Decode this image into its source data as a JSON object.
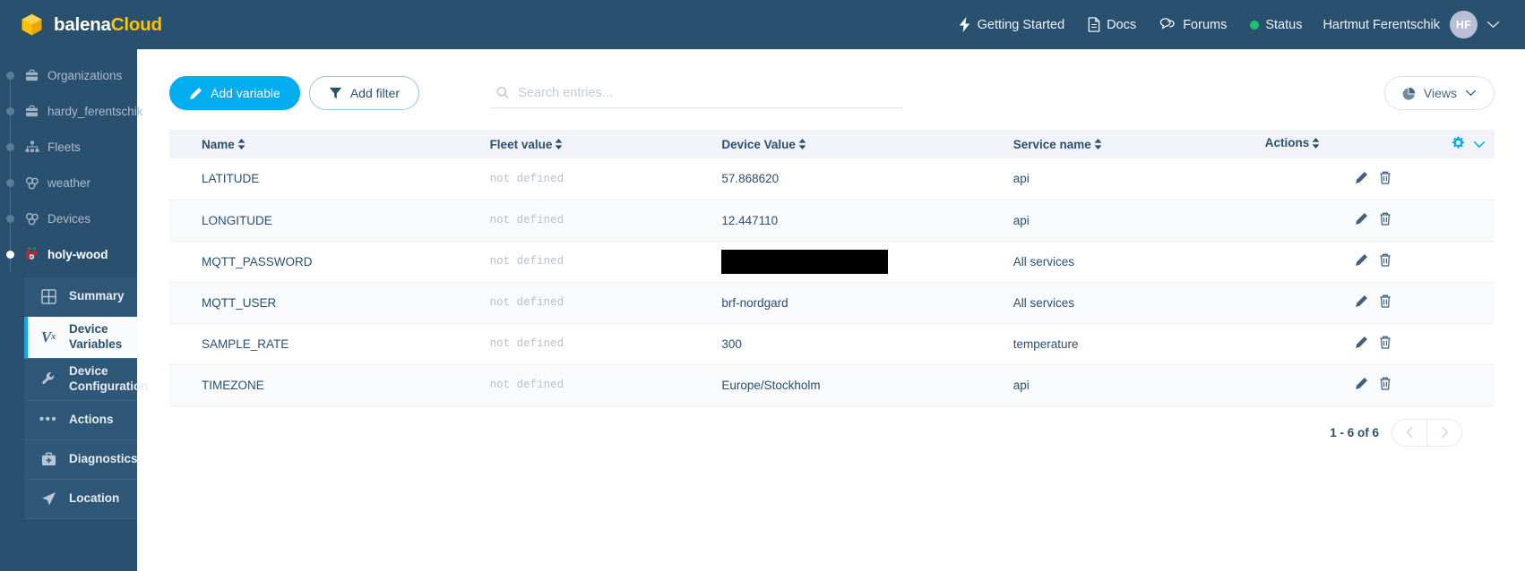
{
  "brand": {
    "part1": "balena",
    "part2": "Cloud",
    "logo_icon": "cube-icon"
  },
  "topnav": {
    "items": [
      {
        "label": "Getting Started",
        "icon": "lightning-bolt-icon"
      },
      {
        "label": "Docs",
        "icon": "document-icon"
      },
      {
        "label": "Forums",
        "icon": "chat-bubbles-icon"
      },
      {
        "label": "Status",
        "icon": "status-dot-icon",
        "dot_color": "#1ec268"
      }
    ],
    "user": {
      "name": "Hartmut Ferentschik",
      "initials": "HF"
    }
  },
  "sidebar": {
    "tree": [
      {
        "label": "Organizations",
        "icon": "briefcase-icon",
        "active": false
      },
      {
        "label": "hardy_ferentschik",
        "icon": "briefcase-icon",
        "active": false
      },
      {
        "label": "Fleets",
        "icon": "fleets-icon",
        "active": false
      },
      {
        "label": "weather",
        "icon": "devices-icon",
        "active": false
      },
      {
        "label": "Devices",
        "icon": "devices-icon",
        "active": false
      },
      {
        "label": "holy-wood",
        "icon": "raspberry-pi-icon",
        "active": true
      }
    ],
    "submenu": [
      {
        "label": "Summary",
        "icon": "grid-icon",
        "selected": false
      },
      {
        "label": "Device Variables",
        "icon": "variable-vx-icon",
        "selected": true
      },
      {
        "label": "Device Configuration",
        "icon": "wrench-icon",
        "selected": false
      },
      {
        "label": "Actions",
        "icon": "ellipsis-icon",
        "selected": false
      },
      {
        "label": "Diagnostics",
        "icon": "medkit-icon",
        "selected": false
      },
      {
        "label": "Location",
        "icon": "paper-plane-icon",
        "selected": false
      }
    ]
  },
  "toolbar": {
    "add_variable_label": "Add variable",
    "add_variable_icon": "pencil-icon",
    "add_filter_label": "Add filter",
    "add_filter_icon": "funnel-icon",
    "views_label": "Views",
    "views_icon": "pie-chart-icon"
  },
  "search": {
    "value": "",
    "placeholder": "Search entries...",
    "icon": "search-icon"
  },
  "table": {
    "columns": [
      {
        "label": "Name",
        "sortable": true
      },
      {
        "label": "Fleet value",
        "sortable": true
      },
      {
        "label": "Device Value",
        "sortable": true
      },
      {
        "label": "Service name",
        "sortable": true
      },
      {
        "label": "Actions",
        "sortable": true
      }
    ],
    "settings_icon": "gear-icon",
    "collapse_icon": "chevron-down-icon",
    "rows": [
      {
        "name": "LATITUDE",
        "fleet_value": "not defined",
        "device_value": "57.868620",
        "redacted": false,
        "service_name": "api"
      },
      {
        "name": "LONGITUDE",
        "fleet_value": "not defined",
        "device_value": "12.447110",
        "redacted": false,
        "service_name": "api"
      },
      {
        "name": "MQTT_PASSWORD",
        "fleet_value": "not defined",
        "device_value": "",
        "redacted": true,
        "service_name": "All services"
      },
      {
        "name": "MQTT_USER",
        "fleet_value": "not defined",
        "device_value": "brf-nordgard",
        "redacted": false,
        "service_name": "All services"
      },
      {
        "name": "SAMPLE_RATE",
        "fleet_value": "not defined",
        "device_value": "300",
        "redacted": false,
        "service_name": "temperature"
      },
      {
        "name": "TIMEZONE",
        "fleet_value": "not defined",
        "device_value": "Europe/Stockholm",
        "redacted": false,
        "service_name": "api"
      }
    ],
    "row_actions": {
      "edit_icon": "pencil-icon",
      "delete_icon": "trash-icon"
    }
  },
  "pagination": {
    "range_label": "1 - 6 of 6",
    "prev_icon": "chevron-left-icon",
    "next_icon": "chevron-right-icon"
  },
  "colors": {
    "brand_blue": "#00aeef",
    "header_navy": "#2a506f",
    "accent_yellow": "#ffc200",
    "status_green": "#1ec268"
  }
}
